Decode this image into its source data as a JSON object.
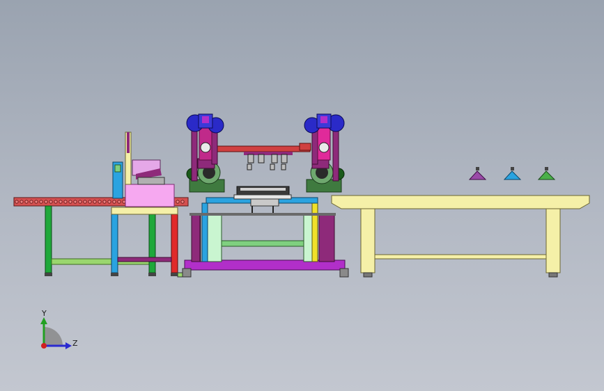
{
  "triad": {
    "y_label": "Y",
    "z_label": "Z"
  },
  "colors": {
    "background_top": "#9aa3b0",
    "background_bottom": "#c3c7d0",
    "conveyor": "#c84c4c",
    "robot_body": "#8e2a7a",
    "robot_motor": "#2a2ac8",
    "table_top": "#f5f0a8",
    "base_frame": "#b12fc9"
  },
  "machine": {
    "components": [
      "roller-conveyor",
      "feeder-frame",
      "pink-material-box",
      "left-robot",
      "right-robot",
      "gripper-beam",
      "center-fixture",
      "robot-base-frame",
      "yellow-table",
      "suction-cup-purple",
      "suction-cup-blue",
      "suction-cup-green"
    ]
  }
}
